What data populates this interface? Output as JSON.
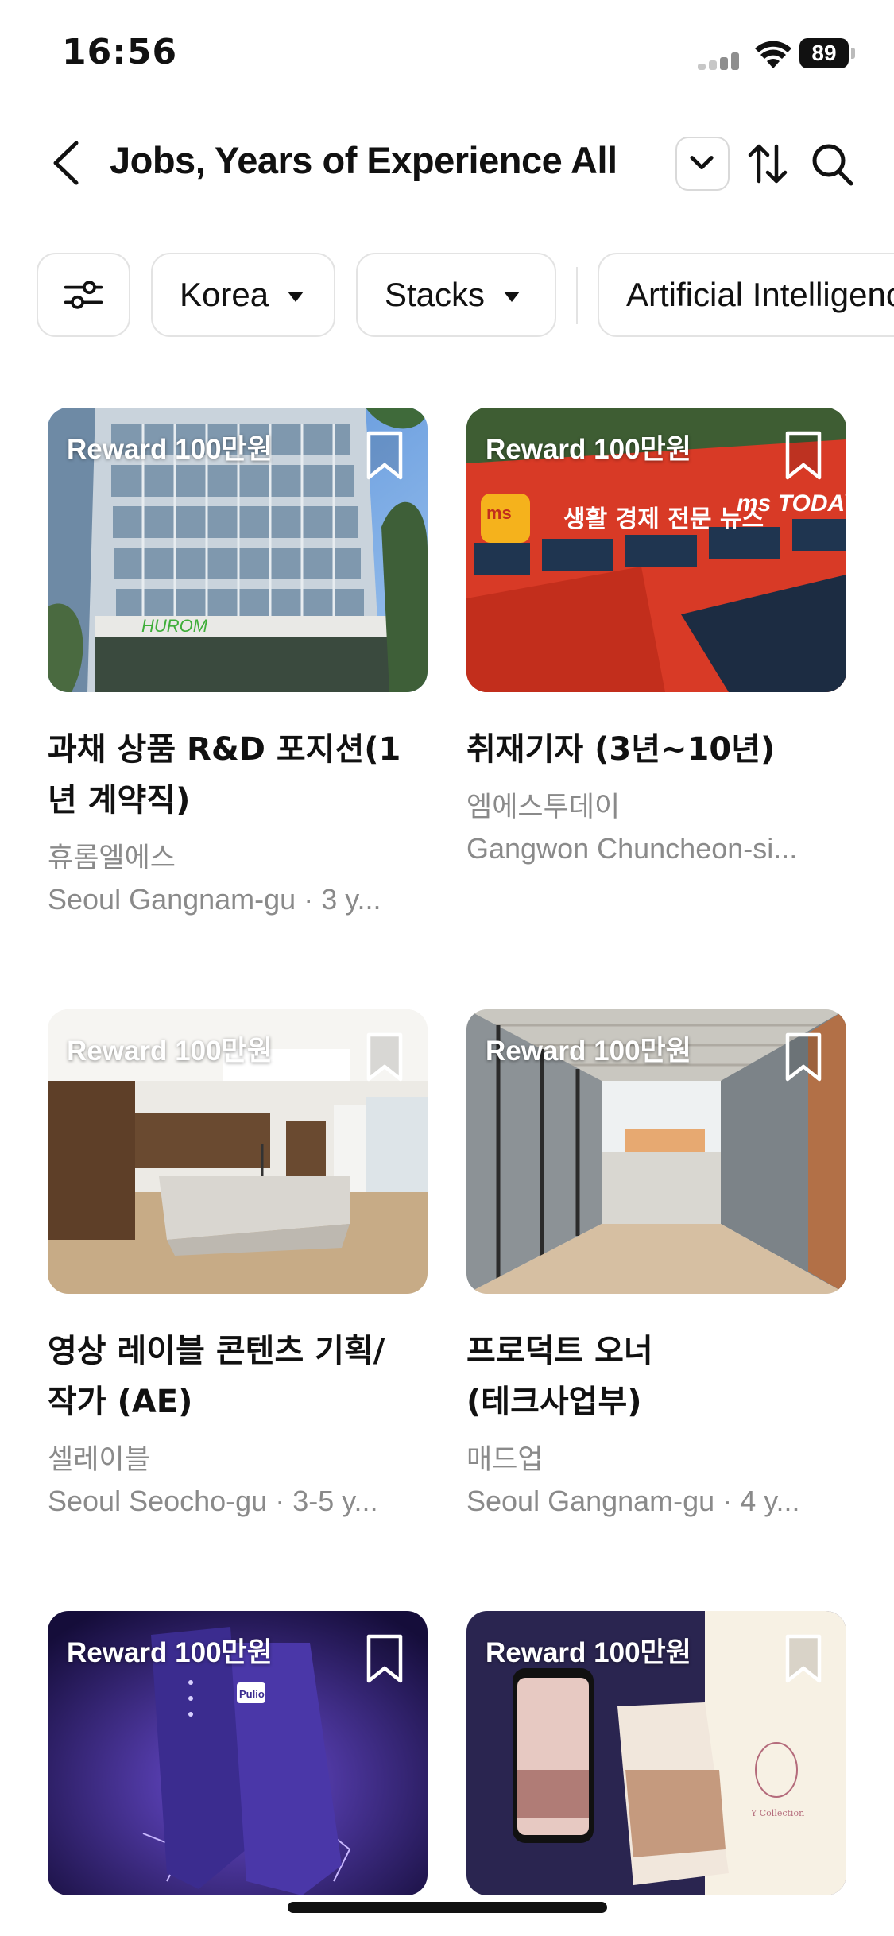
{
  "status_bar": {
    "time": "16:56",
    "battery": "89"
  },
  "header": {
    "title": "Jobs, Years of Experience All"
  },
  "filters": {
    "chips": [
      {
        "label": "Korea"
      },
      {
        "label": "Stacks"
      },
      {
        "label": "Artificial Intelligence"
      }
    ]
  },
  "jobs": [
    {
      "reward": "Reward 100만원",
      "title": "과채 상품 R&D 포지션(1년 계약직)",
      "title_lines": [
        "과채 상품 R&D 포지션(1",
        "년 계약직)"
      ],
      "company": "휴롬엘에스",
      "meta": "Seoul Gangnam-gu · 3 y..."
    },
    {
      "reward": "Reward 100만원",
      "title": "취재기자 (3년~10년)",
      "title_lines": [
        "취재기자 (3년~10년)"
      ],
      "company": "엠에스투데이",
      "meta": "Gangwon Chuncheon-si..."
    },
    {
      "reward": "Reward 100만원",
      "title": "영상 레이블 콘텐츠 기획/작가 (AE)",
      "title_lines": [
        "영상 레이블 콘텐츠 기획/",
        "작가 (AE)"
      ],
      "company": "셀레이블",
      "meta": "Seoul Seocho-gu · 3-5 y..."
    },
    {
      "reward": "Reward 100만원",
      "title": "프로덕트 오너 (테크사업부)",
      "title_lines": [
        "프로덕트 오너",
        "(테크사업부)"
      ],
      "company": "매드업",
      "meta": "Seoul Gangnam-gu · 4 y..."
    },
    {
      "reward": "Reward 100만원"
    },
    {
      "reward": "Reward 100만원"
    }
  ],
  "image_text": {
    "building1_sign": "HUROM",
    "building2_sign": "생활 경제 전문 뉴스",
    "building2_logo": "ms TODAY",
    "product_brand": "Pulio",
    "app_brand": "Y Collection"
  }
}
